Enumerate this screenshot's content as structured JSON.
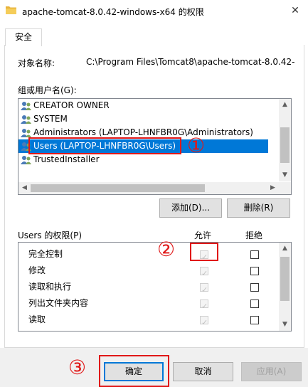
{
  "window": {
    "title": "apache-tomcat-8.0.42-windows-x64 的权限",
    "close_glyph": "✕"
  },
  "tabs": [
    {
      "label": "安全"
    }
  ],
  "object": {
    "label": "对象名称:",
    "value": "C:\\Program Files\\Tomcat8\\apache-tomcat-8.0.42-"
  },
  "groups": {
    "label": "组或用户名(G):",
    "items": [
      {
        "label": "CREATOR OWNER",
        "selected": false
      },
      {
        "label": "SYSTEM",
        "selected": false
      },
      {
        "label": "Administrators (LAPTOP-LHNFBR0G\\Administrators)",
        "selected": false
      },
      {
        "label": "Users (LAPTOP-LHNFBR0G\\Users)",
        "selected": true
      },
      {
        "label": "TrustedInstaller",
        "selected": false
      }
    ]
  },
  "buttons": {
    "add": "添加(D)...",
    "remove": "删除(R)",
    "ok": "确定",
    "cancel": "取消",
    "apply": "应用(A)"
  },
  "permissions": {
    "label": "Users 的权限(P)",
    "allow_header": "允许",
    "deny_header": "拒绝",
    "rows": [
      {
        "name": "完全控制",
        "allow": true,
        "deny": false
      },
      {
        "name": "修改",
        "allow": true,
        "deny": false
      },
      {
        "name": "读取和执行",
        "allow": true,
        "deny": false
      },
      {
        "name": "列出文件夹内容",
        "allow": true,
        "deny": false
      },
      {
        "name": "读取",
        "allow": true,
        "deny": false
      }
    ]
  },
  "annotations": {
    "marker1": "①",
    "marker2": "②",
    "marker3": "③",
    "color": "#e01818"
  },
  "colors": {
    "selection": "#0078d7",
    "highlight_border": "#e01818"
  }
}
